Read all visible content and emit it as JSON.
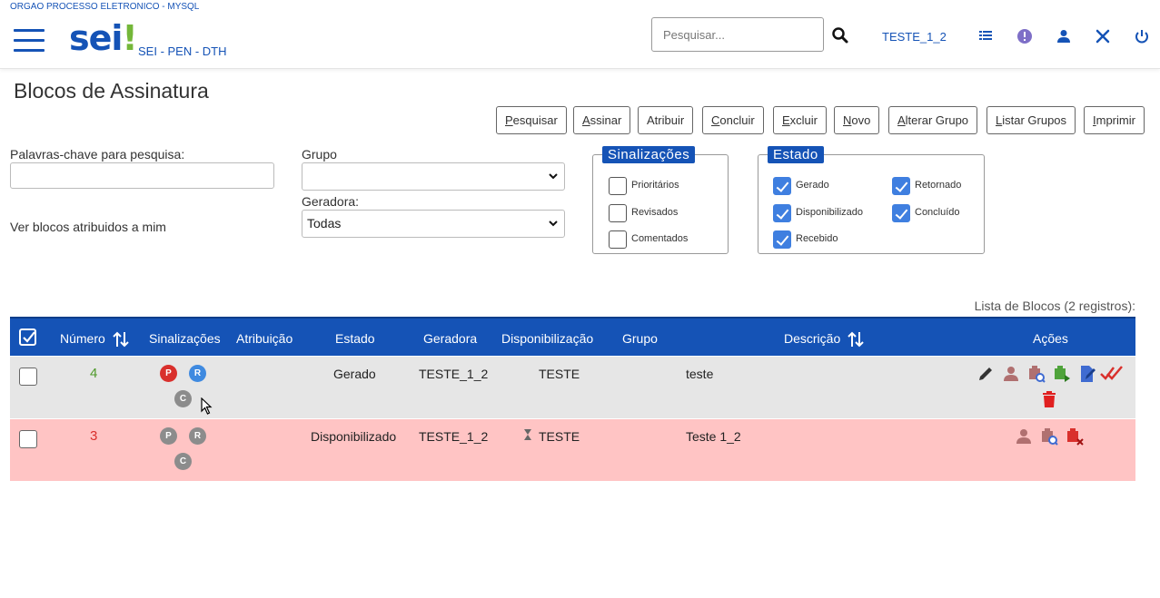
{
  "header": {
    "org_label": "ORGAO PROCESSO ELETRONICO - MYSQL",
    "logo_text": "sei",
    "logo_bang": "!",
    "subtitle": "SEI - PEN - DTH",
    "search_placeholder": "Pesquisar...",
    "unit": "TESTE_1_2",
    "icons": [
      "list-icon",
      "info-icon",
      "user-icon",
      "tools-icon",
      "power-icon"
    ]
  },
  "page": {
    "title": "Blocos de Assinatura"
  },
  "toolbar": {
    "buttons": [
      {
        "first": "P",
        "rest": "esquisar"
      },
      {
        "first": "A",
        "rest": "ssinar"
      },
      {
        "first": "",
        "rest": "Atribuir"
      },
      {
        "first": "C",
        "rest": "oncluir"
      },
      {
        "first": "E",
        "rest": "xcluir"
      },
      {
        "first": "N",
        "rest": "ovo"
      },
      {
        "first": "A",
        "rest": "lterar Grupo"
      },
      {
        "first": "L",
        "rest": "istar Grupos"
      },
      {
        "first": "I",
        "rest": "mprimir"
      }
    ]
  },
  "filters": {
    "keywords_label": "Palavras-chave para pesquisa:",
    "keywords_value": "",
    "ver_atribuidos": "Ver blocos atribuidos a mim",
    "grupo_label": "Grupo",
    "grupo_value": "",
    "geradora_label": "Geradora:",
    "geradora_value": "Todas"
  },
  "sinalizacoes": {
    "legend": "Sinalizações",
    "items": [
      {
        "label": "Prioritários",
        "checked": false
      },
      {
        "label": "Revisados",
        "checked": false
      },
      {
        "label": "Comentados",
        "checked": false
      }
    ]
  },
  "estado": {
    "legend": "Estado",
    "items": [
      {
        "label": "Gerado",
        "checked": true
      },
      {
        "label": "Retornado",
        "checked": true
      },
      {
        "label": "Disponibilizado",
        "checked": true
      },
      {
        "label": "Concluído",
        "checked": true
      },
      {
        "label": "Recebido",
        "checked": true
      }
    ]
  },
  "table": {
    "caption": "Lista de Blocos (2 registros):",
    "columns": [
      "Número",
      "Sinalizações",
      "Atribuição",
      "Estado",
      "Geradora",
      "Disponibilização",
      "Grupo",
      "Descrição",
      "Ações"
    ],
    "rows": [
      {
        "numero": "4",
        "estado": "Gerado",
        "geradora": "TESTE_1_2",
        "disponibilizacao": "TESTE",
        "grupo": "",
        "descricao": "teste",
        "badges": [
          "P",
          "R",
          "C"
        ]
      },
      {
        "numero": "3",
        "estado": "Disponibilizado",
        "geradora": "TESTE_1_2",
        "disponibilizacao": "TESTE",
        "grupo": "",
        "descricao": "Teste 1_2",
        "badges": [
          "P",
          "R",
          "C"
        ]
      }
    ]
  },
  "colors": {
    "primary": "#1553b6",
    "row_gerado": "#e6e6e6",
    "row_disponibilizado": "#ffc4c4",
    "number_green": "#4f9a2a",
    "number_red": "#d9302c"
  }
}
